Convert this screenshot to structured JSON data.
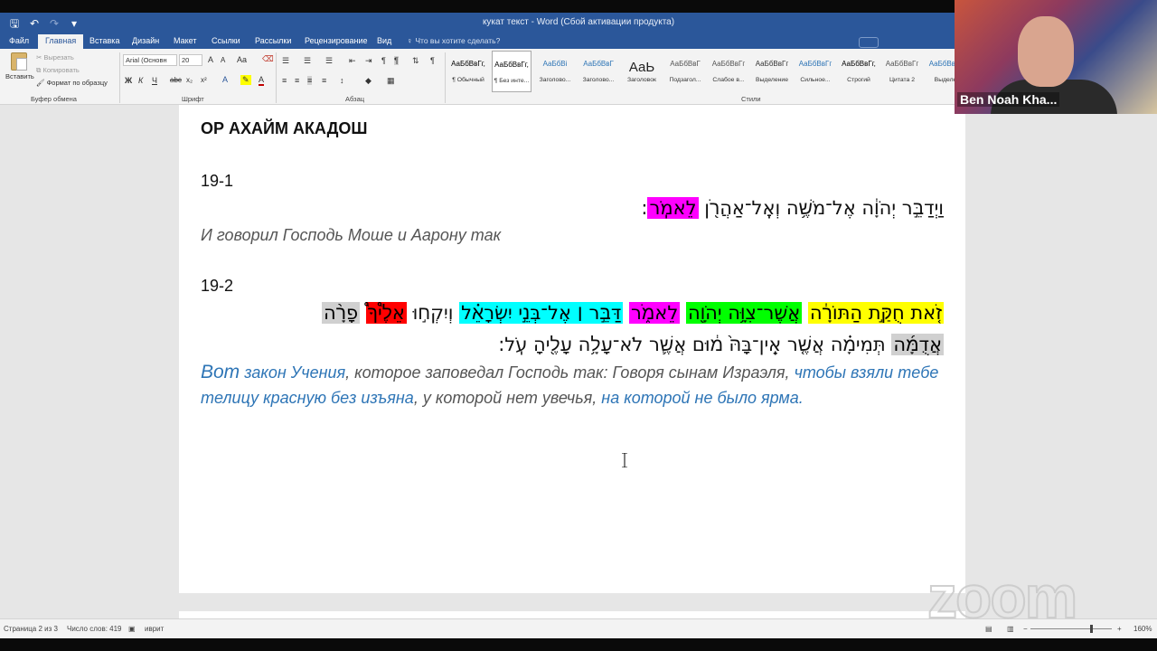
{
  "window": {
    "title": "кукат текст - Word (Сбой активации продукта)"
  },
  "qat": {
    "icons": [
      "save-icon",
      "undo-icon",
      "redo-icon",
      "customize-icon"
    ]
  },
  "tabs": [
    "Файл",
    "Главная",
    "Вставка",
    "Дизайн",
    "Макет",
    "Ссылки",
    "Рассылки",
    "Рецензирование",
    "Вид"
  ],
  "tell_me": "Что вы хотите сделать?",
  "ribbon": {
    "clipboard": {
      "paste": "Вставить",
      "cut": "Вырезать",
      "copy": "Копировать",
      "format_painter": "Формат по образцу",
      "label": "Буфер обмена"
    },
    "font": {
      "name": "Arial (Основн",
      "size": "20",
      "grow": "A",
      "shrink": "A",
      "case": "Aa",
      "bold": "Ж",
      "italic": "К",
      "underline": "Ч",
      "strike": "abc",
      "sub": "x₂",
      "sup": "x²",
      "color": "A",
      "label": "Шрифт"
    },
    "paragraph": {
      "label": "Абзац"
    },
    "styles": {
      "label": "Стили",
      "items": [
        {
          "sample": "АаБбВвГг,",
          "name": "¶ Обычный"
        },
        {
          "sample": "АаБбВвГг,",
          "name": "¶ Без инте..."
        },
        {
          "sample": "АаБбВі",
          "name": "Заголово..."
        },
        {
          "sample": "АаБбВвГ",
          "name": "Заголово..."
        },
        {
          "sample": "АаЬ",
          "name": "Заголовок"
        },
        {
          "sample": "АаБбВвГ",
          "name": "Подзагол..."
        },
        {
          "sample": "АаБбВвГг",
          "name": "Слабое в..."
        },
        {
          "sample": "АаБбВвГг",
          "name": "Выделение"
        },
        {
          "sample": "АаБбВвГг",
          "name": "Сильное..."
        },
        {
          "sample": "АаБбВвГг,",
          "name": "Строгий"
        },
        {
          "sample": "АаБбВвГг",
          "name": "Цитата 2"
        },
        {
          "sample": "АаБбВвГг",
          "name": "Выделе"
        }
      ]
    }
  },
  "document": {
    "heading": "ОР АХАЙМ АКАДОШ",
    "v1_num": "19-1",
    "v1_hebrew": {
      "plain": "וַיְדַבֵּ֣ר יְהֹוָ֔ה אֶל־מֹשֶׁ֥ה וְאֶֽל־אַהֲרֹ֖ן ",
      "hl": "לֵאמֹֽר",
      "end": ":"
    },
    "v1_russian": "И говорил Господь Моше и Аарону так",
    "v2_num": "19-2",
    "v2_hebrew_line1": [
      {
        "text": "זֹ֚את חֻקַּ֣ת הַתּוֹרָ֔ה",
        "color": "#ffff00"
      },
      {
        "text": "אֲשֶׁר־צִוָּ֥ה יְהֹוָ֖ה",
        "color": "#00ff00"
      },
      {
        "text": "לֵאמֹ֑ר",
        "color": "#ff00ff"
      },
      {
        "text": "דַּבֵּ֣ר ׀ אֶל־בְּנֵ֣י יִשְׂרָאֵ֗ל",
        "color": "#00ffff"
      },
      {
        "text": "וְיִקְח֣וּ",
        "color": ""
      },
      {
        "text": "אֵלֶ֩יךָ֩",
        "color": "#ff0000"
      },
      {
        "text": "פָרָ֨ה",
        "color": "#d0d0d0"
      }
    ],
    "v2_hebrew_line2": {
      "hl": "אֲדֻמָּ֜ה",
      "rest": " תְּמִימָ֗ה אֲשֶׁ֤ר אֵֽין־בָּהּ֙ מ֔וּם אֲשֶׁ֛ר לֹא־עָלָ֥ה עָלֶ֖יהָ עֹֽל:"
    },
    "v2_russian": {
      "p1": "Вот",
      "p2": " закон Учения",
      "p3": ", которое заповедал Господь так: Говоря сынам Израэля, ",
      "p4": "чтобы взяли тебе телицу красную без изъяна",
      "p5": ", у которой нет увечья, ",
      "p6": "на которой не было ярма",
      "p7": "."
    }
  },
  "status": {
    "page": "Страница 2 из 3",
    "words": "Число слов: 419",
    "lang": "иврит",
    "zoom": "160%"
  },
  "video": {
    "name": "Ben Noah Kha..."
  },
  "watermark": "zoom"
}
